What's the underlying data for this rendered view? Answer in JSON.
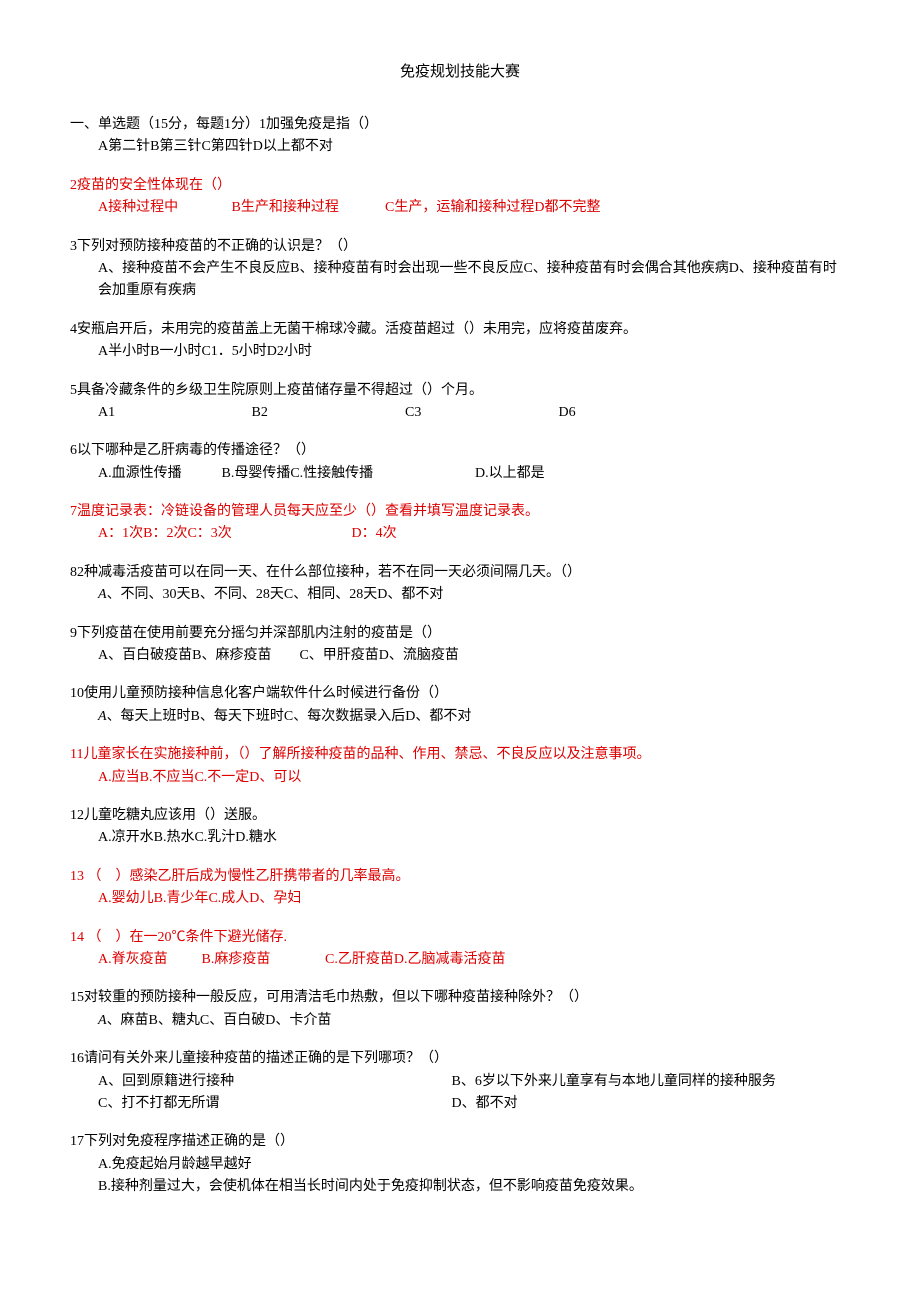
{
  "title": "免疫规划技能大赛",
  "section_header": "一、单选题（15分，每题1分）",
  "q1": {
    "text": "1加强免疫是指（）",
    "opts": "A第二针B第三针C第四针D以上都不对"
  },
  "q2": {
    "text": "2疫苗的安全性体现在（）",
    "a": "A接种过程中",
    "b": "B生产和接种过程",
    "c": "C生产，运输和接种过程D都不完整"
  },
  "q3": {
    "text": "3下列对预防接种疫苗的不正确的认识是？（）",
    "opts": "A、接种疫苗不会产生不良反应B、接种疫苗有时会出现一些不良反应C、接种疫苗有时会偶合其他疾病D、接种疫苗有时会加重原有疾病"
  },
  "q4": {
    "text": "4安瓶启开后，未用完的疫苗盖上无菌干棉球冷藏。活疫苗超过（）未用完，应将疫苗废弃。",
    "opts": "A半小时B一小时C1．5小时D2小时"
  },
  "q5": {
    "text": "5具备冷藏条件的乡级卫生院原则上疫苗储存量不得超过（）个月。",
    "a": "A1",
    "b": "B2",
    "c": "C3",
    "d": "D6"
  },
  "q6": {
    "text": "6以下哪种是乙肝病毒的传播途径？（）",
    "a": "A.血源性传播",
    "b": "B.母婴传播C.性接触传播",
    "d": "D.以上都是"
  },
  "q7": {
    "text": "7温度记录表：冷链设备的管理人员每天应至少（）查看并填写温度记录表。",
    "a": "A：1次B：2次C：3次",
    "d": "D：4次"
  },
  "q8": {
    "text": "82种减毒活疫苗可以在同一天、在什么部位接种，若不在同一天必须间隔几天。（）",
    "a_prefix": "A",
    "opts": "、不同、30天B、不同、28天C、相同、28天D、都不对"
  },
  "q9": {
    "text": "9下列疫苗在使用前要充分摇匀并深部肌内注射的疫苗是（）",
    "opts": "A、百白破疫苗B、麻疹疫苗　　C、甲肝疫苗D、流脑疫苗"
  },
  "q10": {
    "text": "10使用儿童预防接种信息化客户端软件什么时候进行备份（）",
    "a_prefix": "A",
    "opts": "、每天上班时B、每天下班时C、每次数据录入后D、都不对"
  },
  "q11": {
    "text": "11儿童家长在实施接种前，（）了解所接种疫苗的品种、作用、禁忌、不良反应以及注意事项。",
    "opts": "A.应当B.不应当C.不一定D、可以"
  },
  "q12": {
    "text": "12儿童吃糖丸应该用（）送服。",
    "opts": "A.凉开水B.热水C.乳汁D.糖水"
  },
  "q13": {
    "text": "13 （　）感染乙肝后成为慢性乙肝携带者的几率最高。",
    "opts": "A.婴幼儿B.青少年C.成人D、孕妇"
  },
  "q14": {
    "text": "14 （　）在一20℃条件下避光储存.",
    "a": "A.脊灰疫苗",
    "b": "B.麻疹疫苗",
    "c": "C.乙肝疫苗D.乙脑减毒活疫苗"
  },
  "q15": {
    "text": "15对较重的预防接种一般反应，可用清洁毛巾热敷，但以下哪种疫苗接种除外？（）",
    "a_prefix": "A",
    "opts": "、麻苗B、糖丸C、百白破D、卡介苗"
  },
  "q16": {
    "text": "16请问有关外来儿童接种疫苗的描述正确的是下列哪项？（）",
    "a": "A、回到原籍进行接种",
    "b": "B、6岁以下外来儿童享有与本地儿童同样的接种服务",
    "c": "C、打不打都无所谓",
    "d": "D、都不对"
  },
  "q17": {
    "text": "17下列对免疫程序描述正确的是（）",
    "a": "A.免疫起始月龄越早越好",
    "b": "B.接种剂量过大，会使机体在相当长时间内处于免疫抑制状态，但不影响疫苗免疫效果。"
  }
}
